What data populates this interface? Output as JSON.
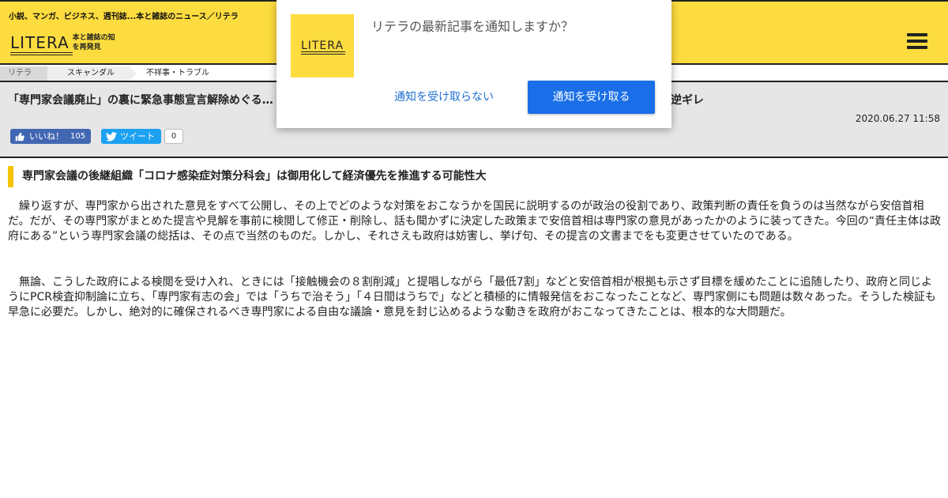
{
  "header": {
    "tagline": "小説、マンガ、ビジネス、週刊誌...本と雑誌のニュース／リテラ",
    "logo_word": "LITERA",
    "logo_sub": "本と雑誌の知を再発見",
    "menu_icon": "hamburger-menu-icon",
    "brand_color": "#fddc3f"
  },
  "breadcrumb": {
    "items": [
      "リテラ",
      "スキャンダル",
      "不祥事・トラブル"
    ]
  },
  "article": {
    "title": "「専門家会議廃止」の裏に緊急事態宣言解除めぐる…",
    "title_tail": "逆ギレ",
    "date": "2020.06.27 11:58",
    "like_label": "いいね！",
    "like_count": "105",
    "tweet_label": "ツイート",
    "tweet_count": "0",
    "section_heading": "専門家会議の後継組織「コロナ感染症対策分科会」は御用化して経済優先を推進する可能性大",
    "paragraphs": [
      "繰り返すが、専門家から出された意見をすべて公開し、その上でどのような対策をおこなうかを国民に説明するのが政治の役割であり、政策判断の責任を負うのは当然ながら安倍首相だ。だが、その専門家がまとめた提言や見解を事前に検閲して修正・削除し、話も聞かずに決定した政策まで安倍首相は専門家の意見があったかのように装ってきた。今回の“責任主体は政府にある”という専門家会議の総括は、その点で当然のものだ。しかし、それさえも政府は妨害し、挙げ句、その提言の文書までをも変更させていたのである。",
      "無論、こうした政府による検閲を受け入れ、ときには「接触機会の８割削減」と提唱しながら「最低7割」などと安倍首相が根拠も示さず目標を緩めたことに追随したり、政府と同じようにPCR検査抑制論に立ち、「専門家有志の会」では「うちで治そう」「４日間はうちで」などと積極的に情報発信をおこなったことなど、専門家側にも問題は数々あった。そうした検証も早急に必要だ。しかし、絶対的に確保されるべき専門家による自由な議論・意見を封じ込めるような動きを政府がおこなってきたことは、根本的な大問題だ。"
    ]
  },
  "notification": {
    "message": "リテラの最新記事を通知しますか？",
    "icon_word": "LITERA",
    "decline_label": "通知を受け取らない",
    "accept_label": "通知を受け取る",
    "accept_color": "#1a6fe8"
  }
}
